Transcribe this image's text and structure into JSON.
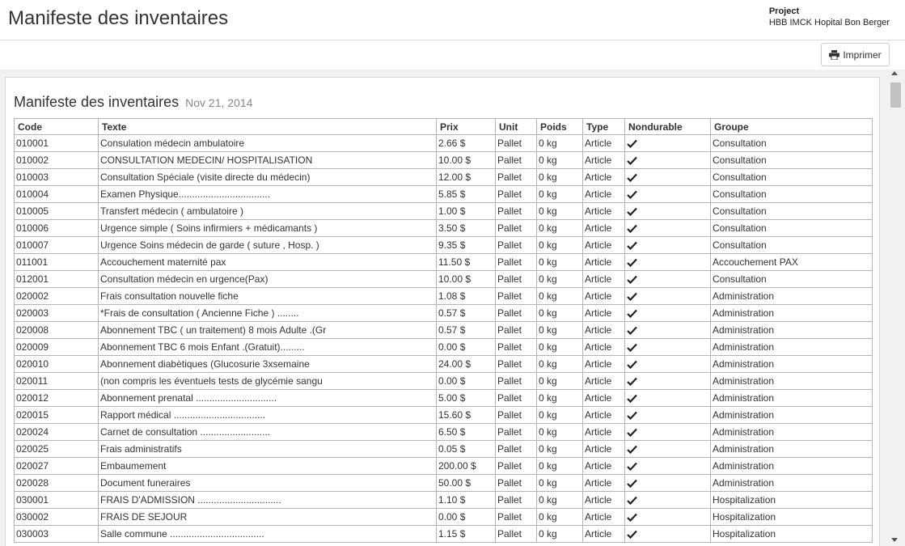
{
  "header": {
    "title": "Manifeste des inventaires",
    "project_label": "Project",
    "project_name": "HBB IMCK Hopital Bon Berger"
  },
  "toolbar": {
    "print_label": "Imprimer",
    "print_icon": "printer-icon"
  },
  "document": {
    "title": "Manifeste des inventaires",
    "date": "Nov 21, 2014"
  },
  "table": {
    "columns": [
      "Code",
      "Texte",
      "Prix",
      "Unit",
      "Poids",
      "Type",
      "Nondurable",
      "Groupe"
    ],
    "check_icon": "checkmark-icon",
    "rows": [
      [
        "010001",
        "Consulation médecin ambulatoire",
        "2.66 $",
        "Pallet",
        "0 kg",
        "Article",
        true,
        "Consultation"
      ],
      [
        "010002",
        "CONSULTATION MEDECIN/ HOSPITALISATION",
        "10.00 $",
        "Pallet",
        "0 kg",
        "Article",
        true,
        "Consultation"
      ],
      [
        "010003",
        "Consultation Spéciale (visite directe du médecin)",
        "12.00 $",
        "Pallet",
        "0 kg",
        "Article",
        true,
        "Consultation"
      ],
      [
        "010004",
        "Examen Physique..................................",
        "5.85 $",
        "Pallet",
        "0 kg",
        "Article",
        true,
        "Consultation"
      ],
      [
        "010005",
        "Transfert médecin ( ambulatoire )",
        "1.00 $",
        "Pallet",
        "0 kg",
        "Article",
        true,
        "Consultation"
      ],
      [
        "010006",
        "Urgence simple ( Soins infirmiers + médicamants )",
        "3.50 $",
        "Pallet",
        "0 kg",
        "Article",
        true,
        "Consultation"
      ],
      [
        "010007",
        "Urgence Soins médecin de garde ( suture , Hosp. )",
        "9.35 $",
        "Pallet",
        "0 kg",
        "Article",
        true,
        "Consultation"
      ],
      [
        "011001",
        "Accouchement maternité pax",
        "11.50 $",
        "Pallet",
        "0 kg",
        "Article",
        true,
        "Accouchement PAX"
      ],
      [
        "012001",
        "Consultation médecin en urgence(Pax)",
        "10.00 $",
        "Pallet",
        "0 kg",
        "Article",
        true,
        "Consultation"
      ],
      [
        "020002",
        "Frais consultation nouvelle fiche",
        "1.08 $",
        "Pallet",
        "0 kg",
        "Article",
        true,
        "Administration"
      ],
      [
        "020003",
        "*Frais de consultation ( Ancienne Fiche ) ........",
        "0.57 $",
        "Pallet",
        "0 kg",
        "Article",
        true,
        "Administration"
      ],
      [
        "020008",
        "Abonnement TBC ( un traitement) 8 mois Adulte .(Gr",
        "0.57 $",
        "Pallet",
        "0 kg",
        "Article",
        true,
        "Administration"
      ],
      [
        "020009",
        "Abonnement TBC 6 mois Enfant .(Gratuit).........",
        "0.00 $",
        "Pallet",
        "0 kg",
        "Article",
        true,
        "Administration"
      ],
      [
        "020010",
        "Abonnement diabètiques (Glucosurie 3xsemaine",
        "24.00 $",
        "Pallet",
        "0 kg",
        "Article",
        true,
        "Administration"
      ],
      [
        "020011",
        "(non compris les éventuels tests de glycémie sangu",
        "0.00 $",
        "Pallet",
        "0 kg",
        "Article",
        true,
        "Administration"
      ],
      [
        "020012",
        "Abonnement prenatal ..............................",
        "5.00 $",
        "Pallet",
        "0 kg",
        "Article",
        true,
        "Administration"
      ],
      [
        "020015",
        "Rapport médical ..................................",
        "15.60 $",
        "Pallet",
        "0 kg",
        "Article",
        true,
        "Administration"
      ],
      [
        "020024",
        "Carnet de consultation ..........................",
        "6.50 $",
        "Pallet",
        "0 kg",
        "Article",
        true,
        "Administration"
      ],
      [
        "020025",
        "Frais administratifs",
        "0.05 $",
        "Pallet",
        "0 kg",
        "Article",
        true,
        "Administration"
      ],
      [
        "020027",
        "Embaumement",
        "200.00 $",
        "Pallet",
        "0 kg",
        "Article",
        true,
        "Administration"
      ],
      [
        "020028",
        "Document funeraires",
        "50.00 $",
        "Pallet",
        "0 kg",
        "Article",
        true,
        "Administration"
      ],
      [
        "030001",
        "FRAIS D'ADMISSION ...............................",
        "1.10 $",
        "Pallet",
        "0 kg",
        "Article",
        true,
        "Hospitalization"
      ],
      [
        "030002",
        "FRAIS DE SEJOUR",
        "0.00 $",
        "Pallet",
        "0 kg",
        "Article",
        true,
        "Hospitalization"
      ],
      [
        "030003",
        "Salle commune ...................................",
        "1.15 $",
        "Pallet",
        "0 kg",
        "Article",
        true,
        "Hospitalization"
      ]
    ]
  },
  "scrollbar": {
    "position": 0.0
  }
}
